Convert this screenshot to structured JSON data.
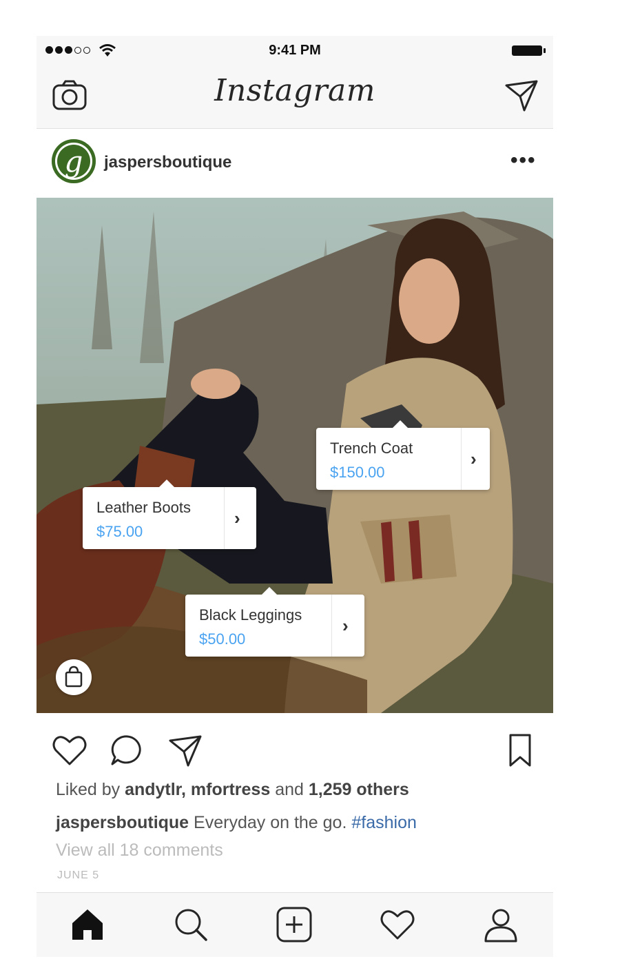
{
  "status_bar": {
    "time": "9:41 PM",
    "signal_icon": "signal-dots-icon",
    "wifi_icon": "wifi-icon",
    "battery_icon": "battery-icon"
  },
  "nav": {
    "title": "Instagram",
    "camera_icon": "camera-icon",
    "direct_icon": "direct-message-icon"
  },
  "post": {
    "username": "jaspersboutique",
    "avatar_letter": "g",
    "more_label": "•••",
    "product_tags": [
      {
        "name": "Trench Coat",
        "price": "$150.00"
      },
      {
        "name": "Leather Boots",
        "price": "$75.00"
      },
      {
        "name": "Black Leggings",
        "price": "$50.00"
      }
    ],
    "chevron": "›",
    "likes": {
      "prefix": "Liked by ",
      "users": "andytlr, mfortress",
      "and": " and ",
      "others": "1,259 others"
    },
    "caption": {
      "username": "jaspersboutique",
      "text": " Everyday on the go. ",
      "hashtag": "#fashion"
    },
    "comments_link": "View all 18 comments",
    "date": "JUNE 5"
  },
  "tab_bar": [
    "home-icon",
    "search-icon",
    "add-post-icon",
    "activity-heart-icon",
    "profile-icon"
  ],
  "colors": {
    "price_blue": "#4aa3f0",
    "hashtag_blue": "#3a6aa8",
    "bar_bg": "#f7f7f7",
    "avatar_green": "#3b6b22"
  }
}
